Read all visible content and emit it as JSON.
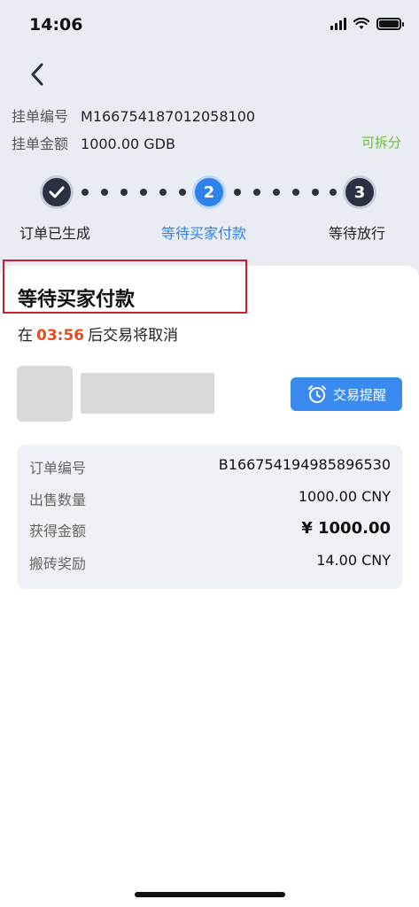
{
  "status_bar": {
    "time": "14:06"
  },
  "listing": {
    "number_label": "挂单编号",
    "number_value": "M166754187012058100",
    "amount_label": "挂单金额",
    "amount_value": "1000.00 GDB",
    "splittable": "可拆分"
  },
  "stepper": {
    "steps": [
      {
        "num": "",
        "label": "订单已生成",
        "state": "done"
      },
      {
        "num": "2",
        "label": "等待买家付款",
        "state": "active"
      },
      {
        "num": "3",
        "label": "等待放行",
        "state": "pending"
      }
    ]
  },
  "card": {
    "title": "等待买家付款",
    "countdown_prefix": "在",
    "countdown_time": "03:56",
    "countdown_suffix": "后交易将取消",
    "remind_button": "交易提醒"
  },
  "details": [
    {
      "key": "订单编号",
      "value": "B166754194985896530"
    },
    {
      "key": "出售数量",
      "value": "1000.00 CNY"
    },
    {
      "key": "获得金额",
      "value": "¥ 1000.00"
    },
    {
      "key": "搬砖奖励",
      "value": "14.00 CNY"
    }
  ],
  "colors": {
    "accent": "#2f82e9",
    "timer": "#e44d1f",
    "splittable": "#6bbf3a",
    "highlight": "#cc1f2f"
  }
}
